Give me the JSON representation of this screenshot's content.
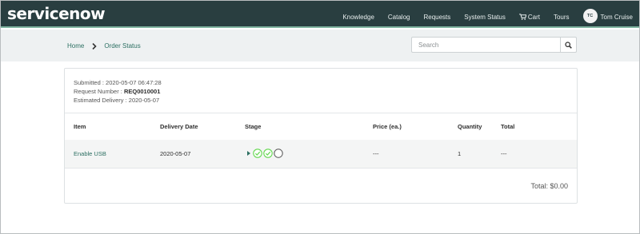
{
  "header": {
    "logo_text": "servicenow",
    "nav": [
      "Knowledge",
      "Catalog",
      "Requests",
      "System Status",
      "Cart",
      "Tours"
    ],
    "user": {
      "initials": "TC",
      "name": "Tom Cruise"
    }
  },
  "breadcrumb": [
    "Home",
    "Order Status"
  ],
  "search": {
    "placeholder": "Search",
    "value": ""
  },
  "order": {
    "submitted_label": "Submitted : ",
    "submitted": "2020-05-07 06:47:28",
    "request_label": "Request Number : ",
    "request_number": "REQ0010001",
    "delivery_label": "Estimated Delivery : ",
    "estimated_delivery": "2020-05-07"
  },
  "table": {
    "columns": [
      "Item",
      "Delivery Date",
      "Stage",
      "Price (ea.)",
      "Quantity",
      "Total"
    ],
    "rows": [
      {
        "item": "Enable USB",
        "delivery_date": "2020-05-07",
        "stage": [
          "complete",
          "complete",
          "pending"
        ],
        "price": "---",
        "quantity": "1",
        "total": "---"
      }
    ]
  },
  "grand_total": "Total: $0.00",
  "colors": {
    "navbar": "#293e40",
    "accent": "#81b5a1",
    "link": "#2c6f62",
    "stage_done": "#62d84e",
    "stage_pending": "#555555"
  },
  "icons": [
    "cart-icon",
    "chevron-right-icon",
    "search-icon",
    "expand-arrow-icon",
    "check-circle-icon",
    "empty-circle-icon"
  ]
}
